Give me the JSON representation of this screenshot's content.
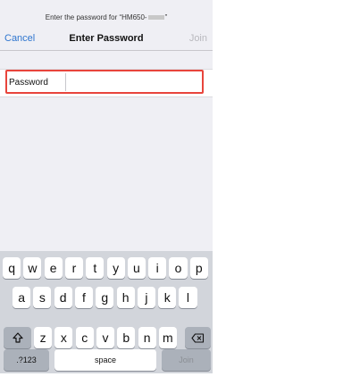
{
  "header": {
    "prompt_prefix": "Enter the password for “HM650-",
    "prompt_suffix": "”",
    "title": "Enter Password",
    "cancel_label": "Cancel",
    "join_label": "Join"
  },
  "form": {
    "password_label": "Password",
    "password_value": ""
  },
  "keyboard": {
    "row1": [
      "q",
      "w",
      "e",
      "r",
      "t",
      "y",
      "u",
      "i",
      "o",
      "p"
    ],
    "row2": [
      "a",
      "s",
      "d",
      "f",
      "g",
      "h",
      "j",
      "k",
      "l"
    ],
    "row3": [
      "z",
      "x",
      "c",
      "v",
      "b",
      "n",
      "m"
    ],
    "numbers_label": ".?123",
    "space_label": "space",
    "join_label": "Join",
    "shift_icon": "shift-arrow-icon",
    "delete_icon": "backspace-icon"
  },
  "colors": {
    "accent": "#2f76cf",
    "highlight": "#e8453c",
    "keyboard_bg": "#d2d5db"
  }
}
